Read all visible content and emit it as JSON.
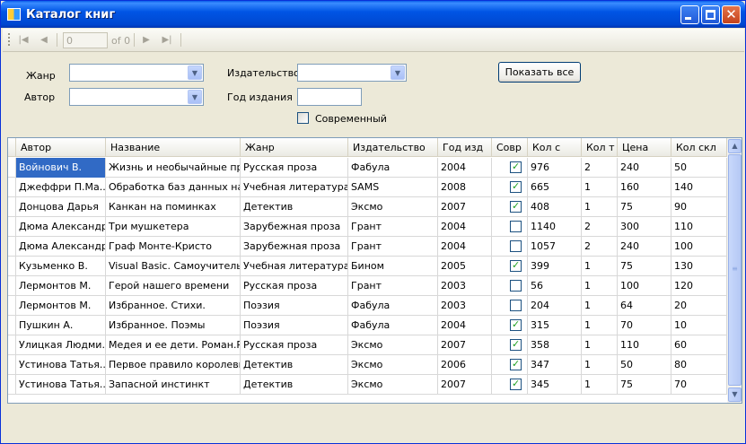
{
  "window": {
    "title": "Каталог книг"
  },
  "navigator": {
    "position": "0",
    "count_text": "of 0"
  },
  "filters": {
    "genre_label": "Жанр",
    "author_label": "Автор",
    "publisher_label": "Издательство",
    "year_label": "Год издания",
    "modern_label": "Современный",
    "show_all_button": "Показать все"
  },
  "grid": {
    "columns": [
      "Автор",
      "Название",
      "Жанр",
      "Издательство",
      "Год изд",
      "Совр",
      "Кол с",
      "Кол т",
      "Цена",
      "Кол скл"
    ],
    "rows": [
      {
        "author": "Войнович В.",
        "title": "Жизнь и необычайные пр...",
        "genre": "Русская проза",
        "publisher": "Фабула",
        "year": "2004",
        "modern": true,
        "pages": "976",
        "volumes": "2",
        "price": "240",
        "stock": "50"
      },
      {
        "author": "Джеффри П.Ма...",
        "title": "Обработка баз данных на...",
        "genre": "Учебная литература",
        "publisher": "SAMS",
        "year": "2008",
        "modern": true,
        "pages": "665",
        "volumes": "1",
        "price": "160",
        "stock": "140"
      },
      {
        "author": "Донцова Дарья",
        "title": "Канкан на поминках",
        "genre": "Детектив",
        "publisher": "Эксмо",
        "year": "2007",
        "modern": true,
        "pages": "408",
        "volumes": "1",
        "price": "75",
        "stock": "90"
      },
      {
        "author": "Дюма Александр",
        "title": "Три мушкетера",
        "genre": "Зарубежная проза",
        "publisher": "Грант",
        "year": "2004",
        "modern": false,
        "pages": "1140",
        "volumes": "2",
        "price": "300",
        "stock": "110"
      },
      {
        "author": "Дюма Александр",
        "title": "Граф Монте-Кристо",
        "genre": "Зарубежная проза",
        "publisher": "Грант",
        "year": "2004",
        "modern": false,
        "pages": "1057",
        "volumes": "2",
        "price": "240",
        "stock": "100"
      },
      {
        "author": "Кузьменко В.",
        "title": "Visual Basic. Самоучитель",
        "genre": "Учебная литература",
        "publisher": "Бином",
        "year": "2005",
        "modern": true,
        "pages": "399",
        "volumes": "1",
        "price": "75",
        "stock": "130"
      },
      {
        "author": "Лермонтов М.",
        "title": "Герой нашего времени",
        "genre": "Русская проза",
        "publisher": "Грант",
        "year": "2003",
        "modern": false,
        "pages": "56",
        "volumes": "1",
        "price": "100",
        "stock": "120"
      },
      {
        "author": "Лермонтов М.",
        "title": "Избранное. Стихи.",
        "genre": "Поэзия",
        "publisher": "Фабула",
        "year": "2003",
        "modern": false,
        "pages": "204",
        "volumes": "1",
        "price": "64",
        "stock": "20"
      },
      {
        "author": "Пушкин А.",
        "title": "Избранное. Поэмы",
        "genre": "Поэзия",
        "publisher": "Фабула",
        "year": "2004",
        "modern": true,
        "pages": "315",
        "volumes": "1",
        "price": "70",
        "stock": "10"
      },
      {
        "author": "Улицкая Людми...",
        "title": "Медея и ее дети. Роман.Р...",
        "genre": "Русская проза",
        "publisher": "Эксмо",
        "year": "2007",
        "modern": true,
        "pages": "358",
        "volumes": "1",
        "price": "110",
        "stock": "60"
      },
      {
        "author": "Устинова Татья...",
        "title": "Первое правило королевы",
        "genre": "Детектив",
        "publisher": "Эксмо",
        "year": "2006",
        "modern": true,
        "pages": "347",
        "volumes": "1",
        "price": "50",
        "stock": "80"
      },
      {
        "author": "Устинова Татья...",
        "title": "Запасной инстинкт",
        "genre": "Детектив",
        "publisher": "Эксмо",
        "year": "2007",
        "modern": true,
        "pages": "345",
        "volumes": "1",
        "price": "75",
        "stock": "70"
      }
    ]
  }
}
